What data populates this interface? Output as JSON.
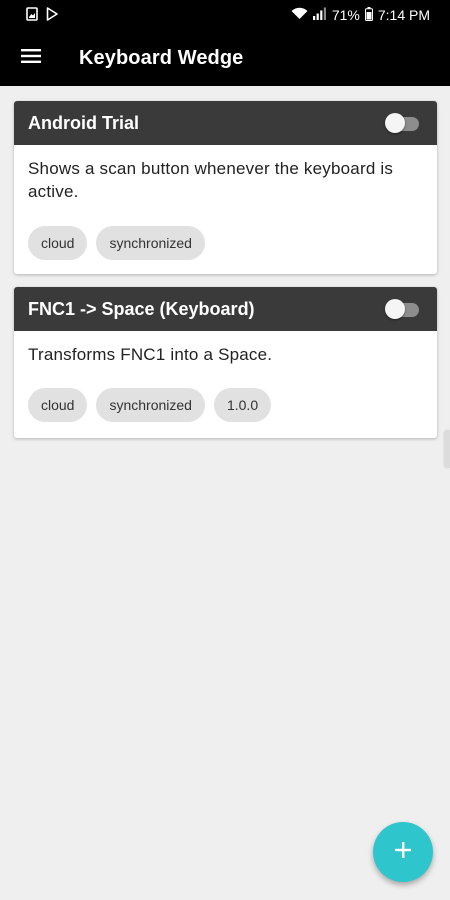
{
  "status_bar": {
    "left_icons": [
      "image-notification-icon",
      "play-store-notification-icon"
    ],
    "right_icons": [
      "wifi-icon",
      "signal-icon"
    ],
    "battery": "71%",
    "time": "7:14 PM"
  },
  "app_bar": {
    "menu_icon": "hamburger-menu-icon",
    "title": "Keyboard Wedge"
  },
  "plugins": [
    {
      "title": "Android Trial",
      "enabled": false,
      "description": "Shows a scan button whenever the keyboard is active.",
      "tags": [
        "cloud",
        "synchronized"
      ]
    },
    {
      "title": "FNC1 -> Space (Keyboard)",
      "enabled": false,
      "description": "Transforms FNC1 into a Space.",
      "tags": [
        "cloud",
        "synchronized",
        "1.0.0"
      ]
    }
  ],
  "fab": {
    "icon": "plus-icon",
    "color": "#2ec6cc"
  },
  "colors": {
    "app_bar": "#000000",
    "card_header": "#3a3a3a",
    "background": "#efefef",
    "chip": "#e1e1e1",
    "fab": "#2ec6cc"
  }
}
